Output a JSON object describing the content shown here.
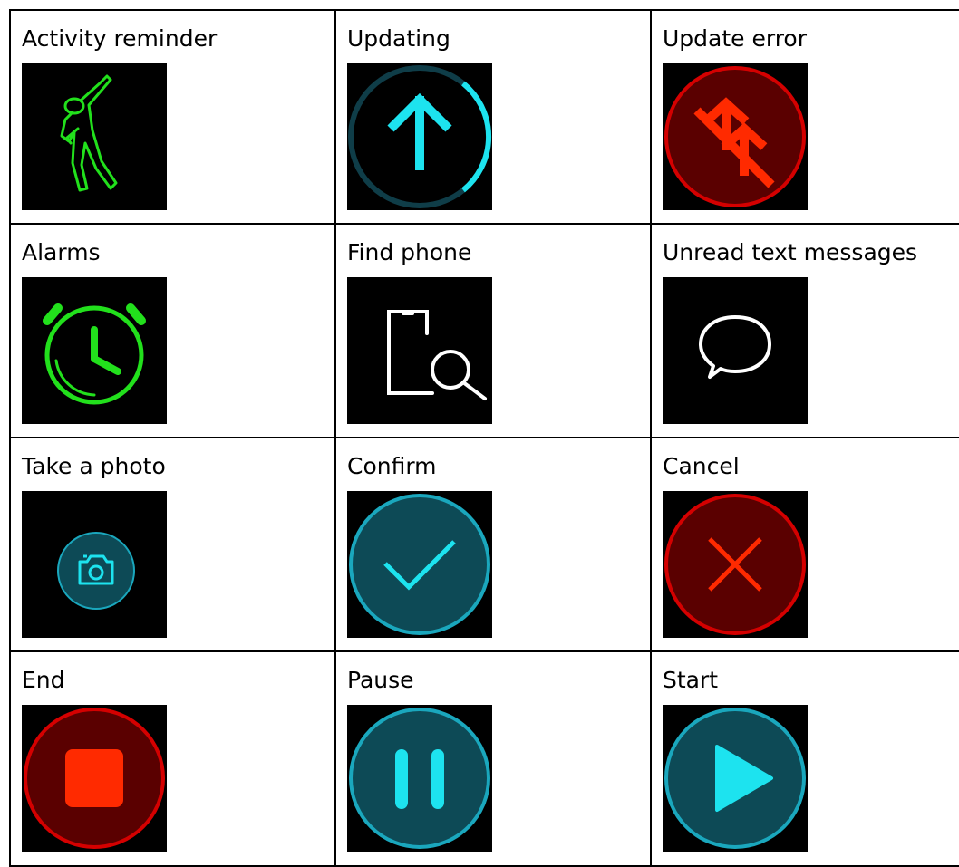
{
  "table": {
    "rows": [
      [
        {
          "label": "Activity reminder",
          "icon": "stretching-person-icon"
        },
        {
          "label": "Updating",
          "icon": "update-arrow-icon"
        },
        {
          "label": "Update error",
          "icon": "update-error-icon"
        }
      ],
      [
        {
          "label": "Alarms",
          "icon": "alarm-clock-icon"
        },
        {
          "label": "Find phone",
          "icon": "find-phone-icon"
        },
        {
          "label": "Unread text messages",
          "icon": "message-bubble-icon"
        }
      ],
      [
        {
          "label": "Take a photo",
          "icon": "camera-icon"
        },
        {
          "label": "Confirm",
          "icon": "checkmark-icon"
        },
        {
          "label": "Cancel",
          "icon": "cancel-x-icon"
        }
      ],
      [
        {
          "label": "End",
          "icon": "stop-icon"
        },
        {
          "label": "Pause",
          "icon": "pause-icon"
        },
        {
          "label": "Start",
          "icon": "play-icon"
        }
      ]
    ]
  },
  "colors": {
    "green": "#22e01c",
    "cyan": "#1de3ef",
    "teal_fill": "#0d4a56",
    "teal_ring": "#1aa7bd",
    "red_fill": "#5a0000",
    "red_ring": "#d40000",
    "red_glyph": "#ff2a00",
    "white": "#ffffff"
  }
}
